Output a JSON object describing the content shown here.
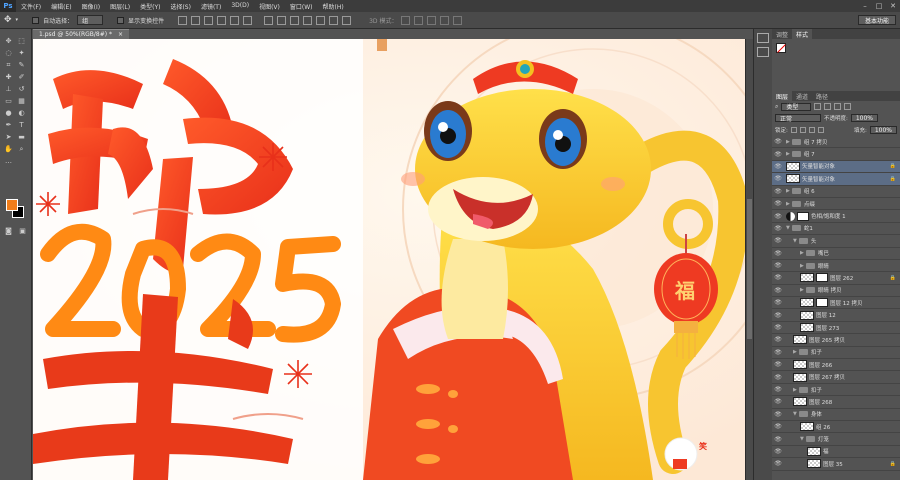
{
  "app": {
    "logo": "Ps"
  },
  "menu": [
    "文件(F)",
    "编辑(E)",
    "图像(I)",
    "图层(L)",
    "类型(Y)",
    "选择(S)",
    "滤镜(T)",
    "3D(D)",
    "视图(V)",
    "窗口(W)",
    "帮助(H)"
  ],
  "window_controls": [
    "–",
    "□",
    "✕"
  ],
  "options": {
    "auto_select_label": "自动选择：",
    "auto_select_value": "组",
    "show_transform_label": "显示变换控件",
    "mode_3d_label": "3D 模式：",
    "workspace": "基本功能"
  },
  "document": {
    "tab_title": "1.psd @ 50%(RGB/8#) *",
    "close": "×"
  },
  "artwork": {
    "char_snake": "蛇",
    "year": "2025",
    "char_bottom": "来",
    "fu": "福",
    "small_sticker": "笑"
  },
  "panels": {
    "top_tabs": [
      "调整",
      "样式"
    ],
    "layer_tabs": [
      "图层",
      "通道",
      "路径"
    ],
    "filter_type": "类型",
    "blend_mode": "正常",
    "opacity_label": "不透明度:",
    "opacity_value": "100%",
    "lock_label": "锁定:",
    "fill_label": "填充:",
    "fill_value": "100%"
  },
  "layers": [
    {
      "name": "组 7 拷贝",
      "type": "folder",
      "indent": 0,
      "selected": false,
      "lock": false
    },
    {
      "name": "组 7",
      "type": "folder",
      "indent": 0,
      "selected": false,
      "lock": false
    },
    {
      "name": "矢量智能对象",
      "type": "smart",
      "indent": 0,
      "selected": true,
      "lock": true
    },
    {
      "name": "矢量智能对象",
      "type": "smart",
      "indent": 0,
      "selected": true,
      "lock": true
    },
    {
      "name": "组 6",
      "type": "folder",
      "indent": 0,
      "selected": false,
      "lock": false
    },
    {
      "name": "点缀",
      "type": "folder",
      "indent": 0,
      "selected": false,
      "lock": false
    },
    {
      "name": "色相/饱和度 1",
      "type": "adjust",
      "indent": 0,
      "selected": false,
      "lock": false
    },
    {
      "name": "蛇1",
      "type": "folder-open",
      "indent": 0,
      "selected": false,
      "lock": false
    },
    {
      "name": "头",
      "type": "folder-open",
      "indent": 1,
      "selected": false,
      "lock": false
    },
    {
      "name": "嘴巴",
      "type": "folder",
      "indent": 2,
      "selected": false,
      "lock": false
    },
    {
      "name": "眼睛",
      "type": "folder",
      "indent": 2,
      "selected": false,
      "lock": false
    },
    {
      "name": "图层 262",
      "type": "mask",
      "indent": 2,
      "selected": false,
      "lock": true
    },
    {
      "name": "眼睛 拷贝",
      "type": "folder",
      "indent": 2,
      "selected": false,
      "lock": false
    },
    {
      "name": "图层 12 拷贝",
      "type": "mask",
      "indent": 2,
      "selected": false,
      "lock": false
    },
    {
      "name": "图层 12",
      "type": "pixel",
      "indent": 2,
      "selected": false,
      "lock": false
    },
    {
      "name": "图层 273",
      "type": "pixel",
      "indent": 2,
      "selected": false,
      "lock": false
    },
    {
      "name": "图层 265 拷贝",
      "type": "pixel",
      "indent": 1,
      "selected": false,
      "lock": false
    },
    {
      "name": "扣子",
      "type": "folder",
      "indent": 1,
      "selected": false,
      "lock": false
    },
    {
      "name": "图层 266",
      "type": "pixel",
      "indent": 1,
      "selected": false,
      "lock": false
    },
    {
      "name": "图层 267 拷贝",
      "type": "pixel",
      "indent": 1,
      "selected": false,
      "lock": false
    },
    {
      "name": "扣子",
      "type": "folder",
      "indent": 1,
      "selected": false,
      "lock": false
    },
    {
      "name": "图层 268",
      "type": "pixel",
      "indent": 1,
      "selected": false,
      "lock": false
    },
    {
      "name": "身体",
      "type": "folder-open",
      "indent": 1,
      "selected": false,
      "lock": false
    },
    {
      "name": "组 26",
      "type": "pixel",
      "indent": 2,
      "selected": false,
      "lock": false
    },
    {
      "name": "灯笼",
      "type": "folder-open",
      "indent": 2,
      "selected": false,
      "lock": false
    },
    {
      "name": "福",
      "type": "pixel",
      "indent": 3,
      "selected": false,
      "lock": false
    },
    {
      "name": "图层 35",
      "type": "pixel",
      "indent": 3,
      "selected": false,
      "lock": true
    }
  ]
}
